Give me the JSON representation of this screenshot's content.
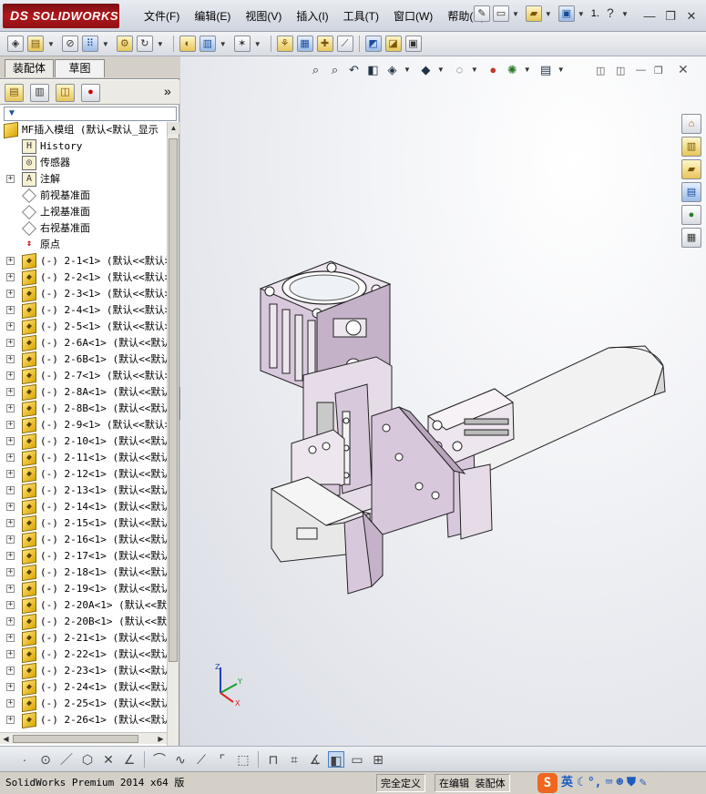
{
  "app": {
    "logo_prefix": "DS",
    "logo_text": "SOLIDWORKS"
  },
  "menu": [
    "文件(F)",
    "编辑(E)",
    "视图(V)",
    "插入(I)",
    "工具(T)",
    "窗口(W)",
    "帮助(H)"
  ],
  "top_right": {
    "page_num": "1."
  },
  "window_controls": {
    "minimize": "—",
    "restore": "❐",
    "close": "✕"
  },
  "left_tabs": {
    "assembly": "装配体",
    "sketch": "草图"
  },
  "filter_icon": "▼",
  "expand_glyph": "»",
  "tree": {
    "root": "MF插入模组  (默认<默认_显示",
    "items": [
      {
        "label": "History",
        "icon": "history-icon",
        "expand": false
      },
      {
        "label": "传感器",
        "icon": "sensor-icon",
        "expand": false
      },
      {
        "label": "注解",
        "icon": "annotation-icon",
        "expand": true
      },
      {
        "label": "前视基准面",
        "icon": "plane-icon",
        "expand": false
      },
      {
        "label": "上视基准面",
        "icon": "plane-icon",
        "expand": false
      },
      {
        "label": "右视基准面",
        "icon": "plane-icon",
        "expand": false
      },
      {
        "label": "原点",
        "icon": "origin-icon",
        "expand": false
      },
      {
        "label": "(-) 2-1<1> (默认<<默认>",
        "icon": "part-icon",
        "expand": true
      },
      {
        "label": "(-) 2-2<1> (默认<<默认>",
        "icon": "part-icon",
        "expand": true
      },
      {
        "label": "(-) 2-3<1> (默认<<默认>",
        "icon": "part-icon",
        "expand": true
      },
      {
        "label": "(-) 2-4<1> (默认<<默认>",
        "icon": "part-icon",
        "expand": true
      },
      {
        "label": "(-) 2-5<1> (默认<<默认>",
        "icon": "part-icon",
        "expand": true
      },
      {
        "label": "(-) 2-6A<1> (默认<<默认",
        "icon": "part-icon",
        "expand": true
      },
      {
        "label": "(-) 2-6B<1> (默认<<默认",
        "icon": "part-icon",
        "expand": true
      },
      {
        "label": "(-) 2-7<1> (默认<<默认>",
        "icon": "part-icon",
        "expand": true
      },
      {
        "label": "(-) 2-8A<1> (默认<<默认",
        "icon": "part-icon",
        "expand": true
      },
      {
        "label": "(-) 2-8B<1> (默认<<默认",
        "icon": "part-icon",
        "expand": true
      },
      {
        "label": "(-) 2-9<1> (默认<<默认>",
        "icon": "part-icon",
        "expand": true
      },
      {
        "label": "(-) 2-10<1> (默认<<默认",
        "icon": "part-icon",
        "expand": true
      },
      {
        "label": "(-) 2-11<1> (默认<<默认",
        "icon": "part-icon",
        "expand": true
      },
      {
        "label": "(-) 2-12<1> (默认<<默认",
        "icon": "part-icon",
        "expand": true
      },
      {
        "label": "(-) 2-13<1> (默认<<默认",
        "icon": "part-icon",
        "expand": true
      },
      {
        "label": "(-) 2-14<1> (默认<<默认",
        "icon": "part-icon",
        "expand": true
      },
      {
        "label": "(-) 2-15<1> (默认<<默认",
        "icon": "part-icon",
        "expand": true
      },
      {
        "label": "(-) 2-16<1> (默认<<默认",
        "icon": "part-icon",
        "expand": true
      },
      {
        "label": "(-) 2-17<1> (默认<<默认",
        "icon": "part-icon",
        "expand": true
      },
      {
        "label": "(-) 2-18<1> (默认<<默认",
        "icon": "part-icon",
        "expand": true
      },
      {
        "label": "(-) 2-19<1> (默认<<默认",
        "icon": "part-icon",
        "expand": true
      },
      {
        "label": "(-) 2-20A<1> (默认<<默认",
        "icon": "part-icon",
        "expand": true
      },
      {
        "label": "(-) 2-20B<1> (默认<<默认",
        "icon": "part-icon",
        "expand": true
      },
      {
        "label": "(-) 2-21<1> (默认<<默认",
        "icon": "part-icon",
        "expand": true
      },
      {
        "label": "(-) 2-22<1> (默认<<默认",
        "icon": "part-icon",
        "expand": true
      },
      {
        "label": "(-) 2-23<1> (默认<<默认",
        "icon": "part-icon",
        "expand": true
      },
      {
        "label": "(-) 2-24<1> (默认<<默认",
        "icon": "part-icon",
        "expand": true
      },
      {
        "label": "(-) 2-25<1> (默认<<默认",
        "icon": "part-icon",
        "expand": true
      },
      {
        "label": "(-) 2-26<1> (默认<<默认",
        "icon": "part-icon",
        "expand": true
      }
    ]
  },
  "status": {
    "app_version": "SolidWorks Premium 2014 x64 版",
    "definition": "完全定义",
    "mode": "在编辑 装配体"
  },
  "ime": {
    "logo": "S",
    "lang": "英"
  },
  "colors": {
    "part": "#d8c8dc",
    "part_dark": "#a895ac",
    "part_light": "#eee6ef",
    "base": "#e8e8e8",
    "brand_red": "#b3161b"
  }
}
